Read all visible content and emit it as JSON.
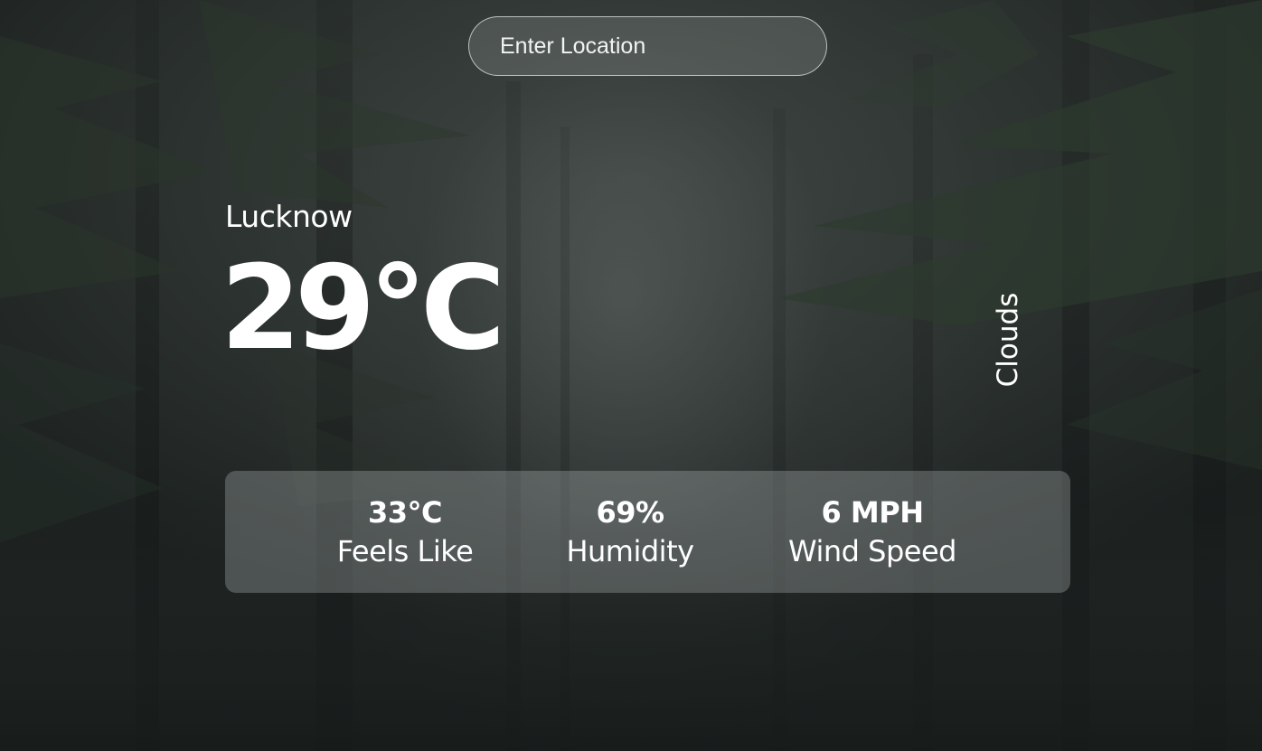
{
  "search": {
    "placeholder": "Enter Location",
    "value": ""
  },
  "weather": {
    "location": "Lucknow",
    "temperature": "29°C",
    "condition": "Clouds"
  },
  "stats": [
    {
      "value": "33°C",
      "label": "Feels Like"
    },
    {
      "value": "69%",
      "label": "Humidity"
    },
    {
      "value": "6 MPH",
      "label": "Wind Speed"
    }
  ],
  "background": {
    "scene": "dark-foggy-forest",
    "base_color": "#1f2423",
    "fog_color": "#5f6664",
    "foliage_color": "#2e3a30"
  },
  "colors": {
    "text": "#ffffff",
    "panel": "rgba(190,196,194,0.30)",
    "input_border": "rgba(235,240,238,0.7)"
  }
}
